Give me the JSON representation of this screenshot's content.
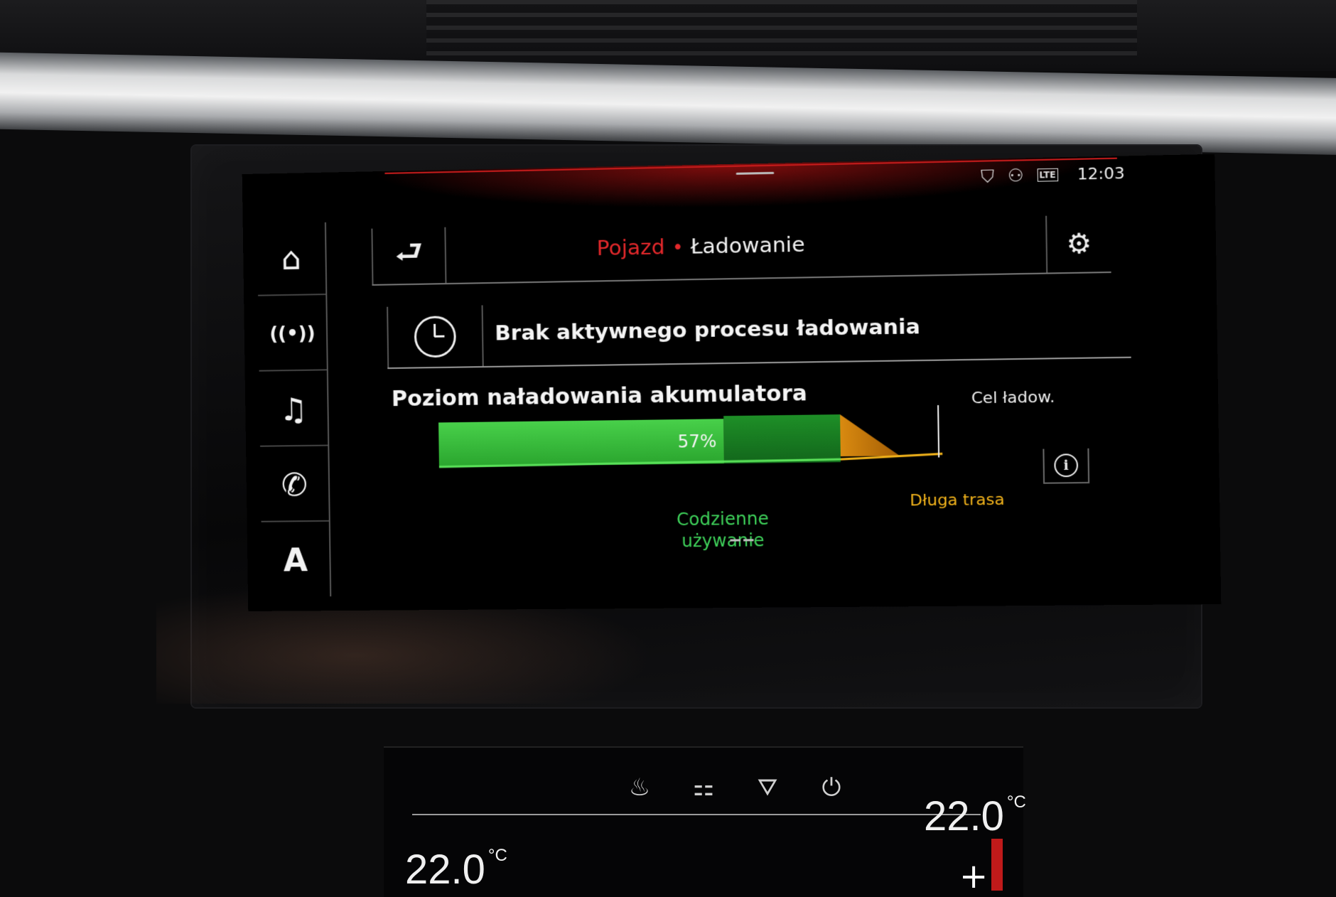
{
  "status_bar": {
    "time": "12:03",
    "network": "LTE"
  },
  "sidenav": {
    "items": [
      {
        "icon": "home-icon",
        "glyph": "⌂"
      },
      {
        "icon": "radio-icon",
        "glyph": "((•))"
      },
      {
        "icon": "music-icon",
        "glyph": "♫"
      },
      {
        "icon": "phone-icon",
        "glyph": "✆"
      },
      {
        "icon": "navigation-icon",
        "glyph": "A"
      }
    ]
  },
  "header": {
    "back_glyph": "⮐",
    "breadcrumb_parent": "Pojazd",
    "separator": "•",
    "breadcrumb_current": "Ładowanie",
    "settings_glyph": "⚙"
  },
  "charging_status": {
    "text": "Brak aktywnego procesu ładowania"
  },
  "battery": {
    "title": "Poziom naładowania akumulatora",
    "target_label": "Cel ładow.",
    "info_glyph": "i",
    "daily_label": "Codzienne używanie",
    "long_trip_label": "Długa trasa"
  },
  "chart_data": {
    "type": "bar",
    "value_label": "57%",
    "state_of_charge_percent": 57,
    "daily_use_limit_percent": 80,
    "long_trip_limit_percent": 100,
    "colors": {
      "charged": "#3fc23f",
      "daily": "#1f8a26",
      "long_trip": "#d98a10"
    }
  },
  "climate": {
    "left_temp": "22.0",
    "right_temp": "22.0",
    "unit": "°C",
    "plus": "+"
  },
  "colors": {
    "accent_red": "#e3282b",
    "green": "#3ed15a",
    "amber": "#f2b31b"
  }
}
